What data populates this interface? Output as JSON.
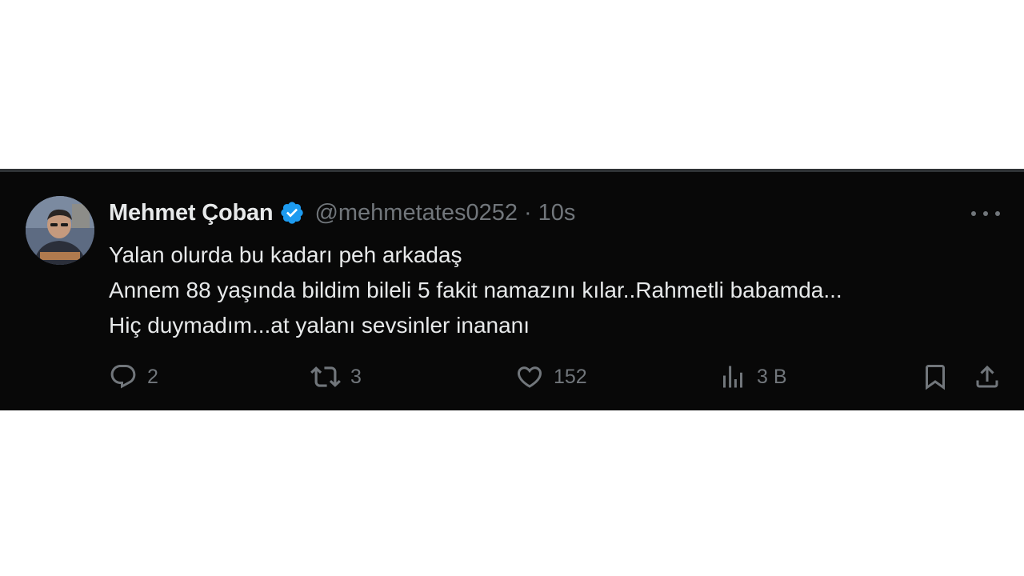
{
  "tweet": {
    "author": {
      "display_name": "Mehmet Çoban",
      "handle": "@mehmetates0252",
      "verified": true,
      "verified_color": "#1d9bf0"
    },
    "separator": "·",
    "time": "10s",
    "text_lines": [
      "Yalan olurda bu kadarı peh arkadaş",
      "Annem 88 yaşında bildim bileli 5 fakit namazını kılar..Rahmetli babamda...",
      "Hiç duymadım...at yalanı sevsinler inananı"
    ],
    "actions": {
      "replies": "2",
      "retweets": "3",
      "likes": "152",
      "views": "3 B"
    },
    "icons": {
      "reply": "reply-icon",
      "retweet": "retweet-icon",
      "like": "heart-icon",
      "views": "views-icon",
      "bookmark": "bookmark-icon",
      "share": "share-icon",
      "more": "more-icon",
      "verified": "verified-badge-icon"
    },
    "colors": {
      "background": "#080808",
      "text": "#e7e9ea",
      "secondary_text": "#71767b"
    }
  }
}
